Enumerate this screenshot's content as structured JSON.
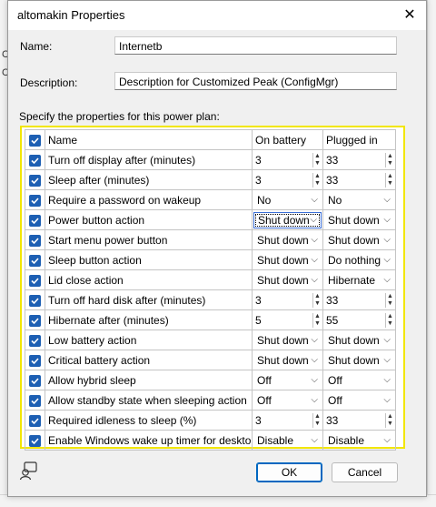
{
  "window": {
    "title": "altomakin Properties",
    "close_glyph": "✕"
  },
  "background": {
    "chars": [
      "C",
      "C"
    ]
  },
  "form": {
    "name_label": "Name:",
    "name_value": "Internetb",
    "description_label": "Description:",
    "description_value": "Description for Customized Peak (ConfigMgr)",
    "section_label": "Specify the properties for this power plan:"
  },
  "table": {
    "headers": {
      "name": "Name",
      "battery": "On battery",
      "plugged": "Plugged in"
    },
    "rows": [
      {
        "name": "Turn off display after (minutes)",
        "battery": "3",
        "plugged": "33",
        "kind": "spin"
      },
      {
        "name": "Sleep after (minutes)",
        "battery": "3",
        "plugged": "33",
        "kind": "spin"
      },
      {
        "name": "Require a password on wakeup",
        "battery": "No",
        "plugged": "No",
        "kind": "dropdown"
      },
      {
        "name": "Power button action",
        "battery": "Shut down",
        "plugged": "Shut down",
        "kind": "dropdown"
      },
      {
        "name": "Start menu power button",
        "battery": "Shut down",
        "plugged": "Shut down",
        "kind": "dropdown"
      },
      {
        "name": "Sleep button action",
        "battery": "Shut down",
        "plugged": "Do nothing",
        "kind": "dropdown"
      },
      {
        "name": "Lid close action",
        "battery": "Shut down",
        "plugged": "Hibernate",
        "kind": "dropdown"
      },
      {
        "name": "Turn off hard disk after (minutes)",
        "battery": "3",
        "plugged": "33",
        "kind": "spin"
      },
      {
        "name": "Hibernate after (minutes)",
        "battery": "5",
        "plugged": "55",
        "kind": "spin"
      },
      {
        "name": "Low battery action",
        "battery": "Shut down",
        "plugged": "Shut down",
        "kind": "dropdown"
      },
      {
        "name": "Critical battery action",
        "battery": "Shut down",
        "plugged": "Shut down",
        "kind": "dropdown"
      },
      {
        "name": "Allow hybrid sleep",
        "battery": "Off",
        "plugged": "Off",
        "kind": "dropdown"
      },
      {
        "name": "Allow standby state when sleeping action",
        "battery": "Off",
        "plugged": "Off",
        "kind": "dropdown"
      },
      {
        "name": "Required idleness to sleep (%)",
        "battery": "3",
        "plugged": "33",
        "kind": "spin"
      },
      {
        "name": "Enable Windows wake up timer for desktop ...",
        "battery": "Disable",
        "plugged": "Disable",
        "kind": "dropdown"
      }
    ]
  },
  "buttons": {
    "ok": "OK",
    "cancel": "Cancel"
  },
  "colors": {
    "checkbox": "#1d5fb3",
    "highlight_border": "#f2e600",
    "focus": "#3a6ed6"
  }
}
